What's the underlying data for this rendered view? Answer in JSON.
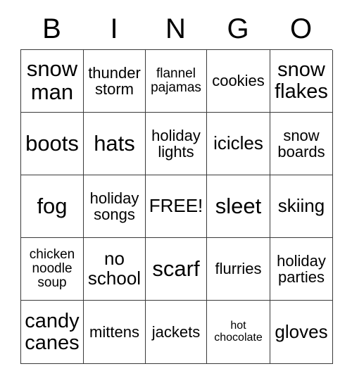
{
  "card": {
    "header": {
      "letters": [
        "B",
        "I",
        "N",
        "G",
        "O"
      ]
    },
    "grid": {
      "rows": [
        [
          {
            "text": "snow\nman",
            "size": "fs-xl"
          },
          {
            "text": "thunder\nstorm",
            "size": "fs-sm"
          },
          {
            "text": "flannel\npajamas",
            "size": "fs-xs"
          },
          {
            "text": "cookies",
            "size": "fs-sm"
          },
          {
            "text": "snow\nflakes",
            "size": "fs-lg"
          }
        ],
        [
          {
            "text": "boots",
            "size": "fs-xl"
          },
          {
            "text": "hats",
            "size": "fs-xl"
          },
          {
            "text": "holiday\nlights",
            "size": "fs-sm"
          },
          {
            "text": "icicles",
            "size": "fs-md"
          },
          {
            "text": "snow\nboards",
            "size": "fs-sm"
          }
        ],
        [
          {
            "text": "fog",
            "size": "fs-xl"
          },
          {
            "text": "holiday\nsongs",
            "size": "fs-sm"
          },
          {
            "text": "FREE!",
            "size": "fs-md"
          },
          {
            "text": "sleet",
            "size": "fs-xl"
          },
          {
            "text": "skiing",
            "size": "fs-md"
          }
        ],
        [
          {
            "text": "chicken\nnoodle\nsoup",
            "size": "fs-xs"
          },
          {
            "text": "no\nschool",
            "size": "fs-md"
          },
          {
            "text": "scarf",
            "size": "fs-xl"
          },
          {
            "text": "flurries",
            "size": "fs-sm"
          },
          {
            "text": "holiday\nparties",
            "size": "fs-sm"
          }
        ],
        [
          {
            "text": "candy\ncanes",
            "size": "fs-lg"
          },
          {
            "text": "mittens",
            "size": "fs-sm"
          },
          {
            "text": "jackets",
            "size": "fs-sm"
          },
          {
            "text": "hot\nchocolate",
            "size": "fs-xxs"
          },
          {
            "text": "gloves",
            "size": "fs-md"
          }
        ]
      ]
    },
    "colors": {
      "border": "#3a3a3a",
      "text": "#000000",
      "background": "#ffffff"
    }
  }
}
